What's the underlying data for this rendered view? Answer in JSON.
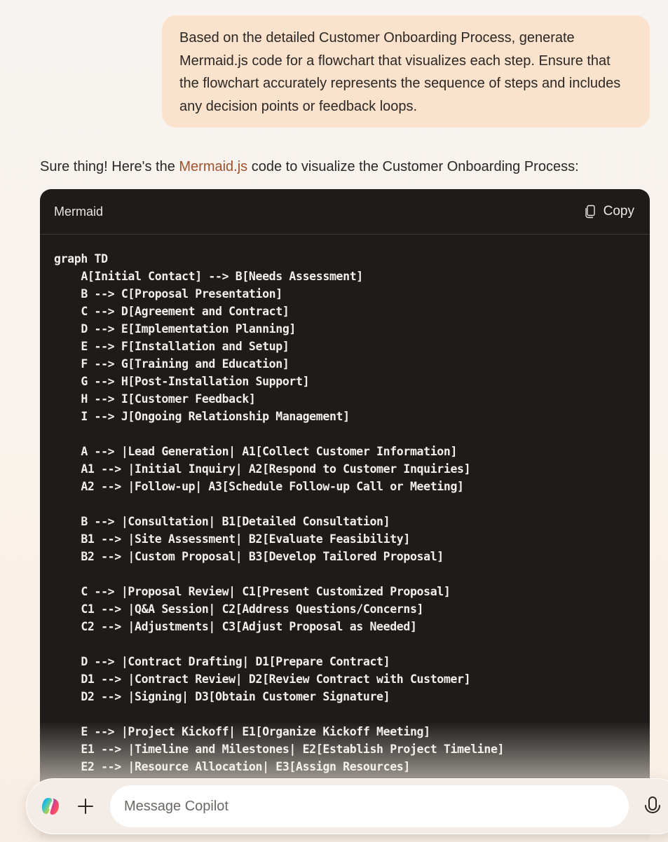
{
  "user_message": {
    "text": "Based on the detailed Customer Onboarding Process, generate Mermaid.js code for a flowchart that visualizes each step. Ensure that the flowchart accurately represents the sequence of steps and includes any decision points or feedback loops."
  },
  "assistant_reply": {
    "intro_before_link": "Sure thing! Here's the ",
    "link_text": "Mermaid.js",
    "intro_after_link": " code to visualize the Customer Onboarding Process:",
    "link_color": "#a0522d"
  },
  "code_block": {
    "language": "Mermaid",
    "copy_label": "Copy",
    "lines": [
      "graph TD",
      "    A[Initial Contact] --> B[Needs Assessment]",
      "    B --> C[Proposal Presentation]",
      "    C --> D[Agreement and Contract]",
      "    D --> E[Implementation Planning]",
      "    E --> F[Installation and Setup]",
      "    F --> G[Training and Education]",
      "    G --> H[Post-Installation Support]",
      "    H --> I[Customer Feedback]",
      "    I --> J[Ongoing Relationship Management]",
      "",
      "    A --> |Lead Generation| A1[Collect Customer Information]",
      "    A1 --> |Initial Inquiry| A2[Respond to Customer Inquiries]",
      "    A2 --> |Follow-up| A3[Schedule Follow-up Call or Meeting]",
      "",
      "    B --> |Consultation| B1[Detailed Consultation]",
      "    B1 --> |Site Assessment| B2[Evaluate Feasibility]",
      "    B2 --> |Custom Proposal| B3[Develop Tailored Proposal]",
      "",
      "    C --> |Proposal Review| C1[Present Customized Proposal]",
      "    C1 --> |Q&A Session| C2[Address Questions/Concerns]",
      "    C2 --> |Adjustments| C3[Adjust Proposal as Needed]",
      "",
      "    D --> |Contract Drafting| D1[Prepare Contract]",
      "    D1 --> |Contract Review| D2[Review Contract with Customer]",
      "    D2 --> |Signing| D3[Obtain Customer Signature]",
      "",
      "    E --> |Project Kickoff| E1[Organize Kickoff Meeting]",
      "    E1 --> |Timeline and Milestones| E2[Establish Project Timeline]",
      "    E2 --> |Resource Allocation| E3[Assign Resources]"
    ]
  },
  "composer": {
    "placeholder": "Message Copilot",
    "value": "",
    "icons": {
      "logo": "copilot-logo-icon",
      "add": "plus-icon",
      "voice": "microphone-icon"
    }
  }
}
